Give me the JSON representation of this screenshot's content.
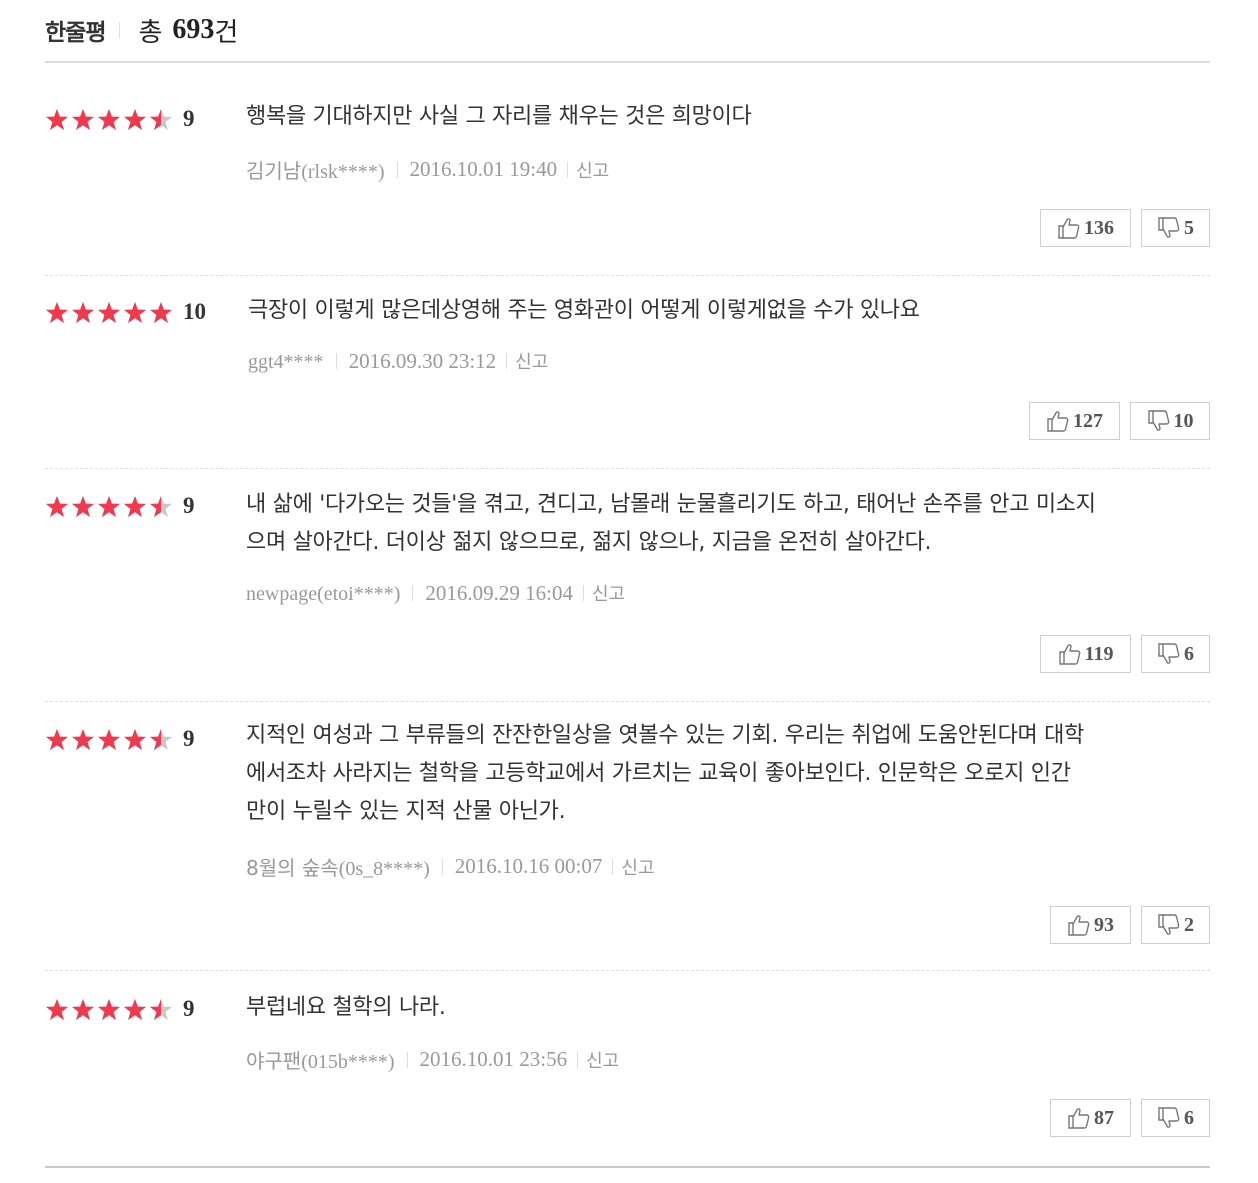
{
  "header": {
    "title": "한줄평",
    "total_label": "총",
    "total_count": "693",
    "total_unit": "건"
  },
  "icons": {
    "star": "star-icon",
    "like": "thumbs-up-icon",
    "dislike": "thumbs-down-icon"
  },
  "colors": {
    "star_filled": "#f0394f",
    "star_empty": "#c8c8c8"
  },
  "reviews": [
    {
      "stars": 4.5,
      "score": "9",
      "text_lines": [
        "행복을 기대하지만 사실 그 자리를 채우는 것은 희망이다"
      ],
      "author_ko": "김기남",
      "author_en": "(rlsk****)",
      "date": "2016.10.01 19:40",
      "report": "신고",
      "likes": "136",
      "dislikes": "5"
    },
    {
      "stars": 5,
      "score": "10",
      "text_lines": [
        "극장이 이렇게 많은데상영해 주는 영화관이 어떻게 이렇게없을 수가 있나요"
      ],
      "author_ko": "",
      "author_en": "ggt4****",
      "date": "2016.09.30 23:12",
      "report": "신고",
      "likes": "127",
      "dislikes": "10"
    },
    {
      "stars": 4.5,
      "score": "9",
      "text_lines": [
        "내 삶에 '다가오는 것들'을 겪고, 견디고, 남몰래 눈물흘리기도 하고, 태어난 손주를 안고 미소지",
        "으며 살아간다. 더이상 젊지 않으므로, 젊지 않으나, 지금을 온전히 살아간다."
      ],
      "author_ko": "",
      "author_en": "newpage(etoi****)",
      "date": "2016.09.29 16:04",
      "report": "신고",
      "likes": "119",
      "dislikes": "6"
    },
    {
      "stars": 4.5,
      "score": "9",
      "text_lines": [
        "지적인 여성과 그 부류들의 잔잔한일상을 엿볼수 있는 기회. 우리는 취업에 도움안된다며 대학",
        "에서조차 사라지는 철학을 고등학교에서 가르치는 교육이 좋아보인다. 인문학은 오로지 인간",
        "만이 누릴수 있는 지적 산물 아닌가."
      ],
      "author_ko": "8월의 숲속",
      "author_en": "(0s_8****)",
      "date": "2016.10.16 00:07",
      "report": "신고",
      "likes": "93",
      "dislikes": "2"
    },
    {
      "stars": 4.5,
      "score": "9",
      "text_lines": [
        "부럽네요 철학의 나라."
      ],
      "author_ko": "야구팬",
      "author_en": "(015b****)",
      "date": "2016.10.01 23:56",
      "report": "신고",
      "likes": "87",
      "dislikes": "6"
    }
  ]
}
